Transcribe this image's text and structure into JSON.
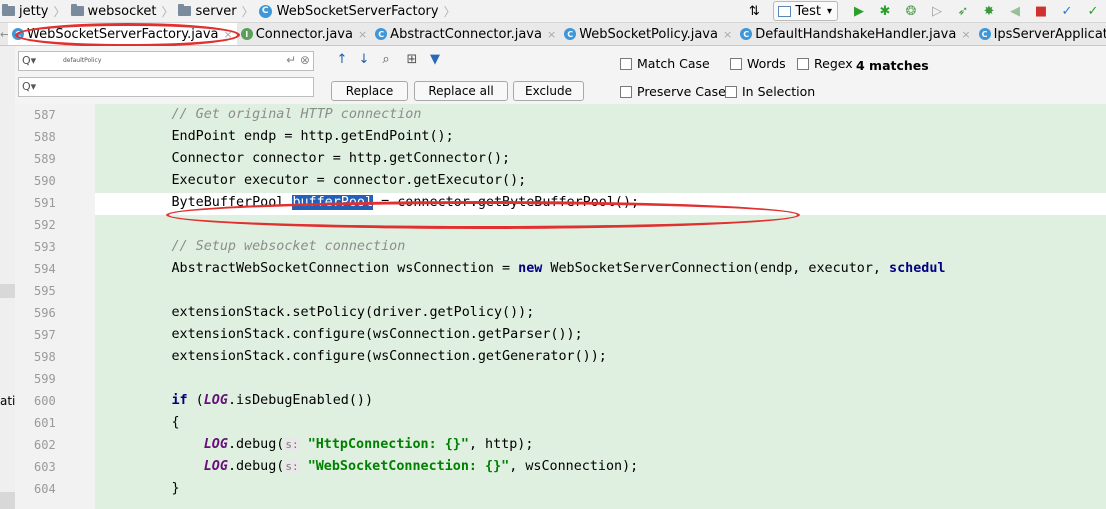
{
  "breadcrumb": [
    {
      "icon": "folder-icon",
      "label": "jetty"
    },
    {
      "icon": "folder-icon",
      "label": "websocket"
    },
    {
      "icon": "folder-icon",
      "label": "server"
    },
    {
      "icon": "class-icon",
      "label": "WebSocketServerFactory"
    }
  ],
  "toolbar": {
    "run_config": "Test",
    "tools": [
      "sort-icon",
      "run-icon",
      "debug-icon",
      "coverage-icon",
      "profile-icon",
      "build-icon",
      "attach-icon",
      "back-icon",
      "stop-icon",
      "vcs-update-icon",
      "vcs-commit-icon"
    ]
  },
  "tabs": [
    {
      "label": "WebSocketServerFactory.java",
      "icon_letter": "C",
      "icon_color": "#3d97d8",
      "active": true
    },
    {
      "label": "Connector.java",
      "icon_letter": "I",
      "icon_color": "#5aa05a",
      "active": false
    },
    {
      "label": "AbstractConnector.java",
      "icon_letter": "C",
      "icon_color": "#3d97d8",
      "active": false
    },
    {
      "label": "WebSocketPolicy.java",
      "icon_letter": "C",
      "icon_color": "#3d97d8",
      "active": false
    },
    {
      "label": "DefaultHandshakeHandler.java",
      "icon_letter": "C",
      "icon_color": "#3d97d8",
      "active": false
    },
    {
      "label": "IpsServerApplicati",
      "icon_letter": "C",
      "icon_color": "#3d97d8",
      "active": false
    }
  ],
  "find": {
    "search_value": "defaultPolicy",
    "replace_value": "",
    "replace_label": "Replace",
    "replace_all_label": "Replace all",
    "exclude_label": "Exclude",
    "match_case": "Match Case",
    "words": "Words",
    "regex": "Regex",
    "matches": "4 matches",
    "preserve_case": "Preserve Case",
    "in_selection": "In Selection"
  },
  "side_label": "ati",
  "code": {
    "highlight_color": "#e0f0e0",
    "selection_color": "#2260ba",
    "annotation_color": "#e03030",
    "top_partial_line": "586",
    "lines": [
      {
        "n": "587",
        "parts": [
          {
            "t": "        "
          },
          {
            "t": "// Get original HTTP connection",
            "c": "cm"
          }
        ]
      },
      {
        "n": "588",
        "parts": [
          {
            "t": "        EndPoint endp = http.getEndPoint();"
          }
        ]
      },
      {
        "n": "589",
        "parts": [
          {
            "t": "        Connector connector = http.getConnector();"
          }
        ]
      },
      {
        "n": "590",
        "parts": [
          {
            "t": "        Executor executor = connector.getExecutor();"
          }
        ]
      },
      {
        "n": "591",
        "current": true,
        "parts": [
          {
            "t": "        ByteBufferPool "
          },
          {
            "t": "bufferPool",
            "c": "sel"
          },
          {
            "t": " = connector.getByteBufferPool();"
          }
        ]
      },
      {
        "n": "592",
        "parts": [
          {
            "t": ""
          }
        ]
      },
      {
        "n": "593",
        "parts": [
          {
            "t": "        "
          },
          {
            "t": "// Setup websocket connection",
            "c": "cm"
          }
        ]
      },
      {
        "n": "594",
        "parts": [
          {
            "t": "        AbstractWebSocketConnection wsConnection = "
          },
          {
            "t": "new",
            "c": "kw"
          },
          {
            "t": " WebSocketServerConnection(endp, executor, "
          },
          {
            "t": "schedul",
            "c": "kw"
          }
        ]
      },
      {
        "n": "595",
        "parts": [
          {
            "t": ""
          }
        ]
      },
      {
        "n": "596",
        "parts": [
          {
            "t": "        extensionStack.setPolicy(driver.getPolicy());"
          }
        ]
      },
      {
        "n": "597",
        "parts": [
          {
            "t": "        extensionStack.configure(wsConnection.getParser());"
          }
        ]
      },
      {
        "n": "598",
        "parts": [
          {
            "t": "        extensionStack.configure(wsConnection.getGenerator());"
          }
        ]
      },
      {
        "n": "599",
        "parts": [
          {
            "t": ""
          }
        ]
      },
      {
        "n": "600",
        "parts": [
          {
            "t": "        "
          },
          {
            "t": "if",
            "c": "kw"
          },
          {
            "t": " ("
          },
          {
            "t": "LOG",
            "c": "sf"
          },
          {
            "t": ".isDebugEnabled())"
          }
        ]
      },
      {
        "n": "601",
        "parts": [
          {
            "t": "        {"
          }
        ]
      },
      {
        "n": "602",
        "parts": [
          {
            "t": "            "
          },
          {
            "t": "LOG",
            "c": "sf"
          },
          {
            "t": ".debug("
          },
          {
            "t": "s:",
            "c": "hint"
          },
          {
            "t": " "
          },
          {
            "t": "\"HttpConnection: {}\"",
            "c": "st"
          },
          {
            "t": ", http);"
          }
        ]
      },
      {
        "n": "603",
        "parts": [
          {
            "t": "            "
          },
          {
            "t": "LOG",
            "c": "sf"
          },
          {
            "t": ".debug("
          },
          {
            "t": "s:",
            "c": "hint"
          },
          {
            "t": " "
          },
          {
            "t": "\"WebSocketConnection: {}\"",
            "c": "st"
          },
          {
            "t": ", wsConnection);"
          }
        ]
      },
      {
        "n": "604",
        "parts": [
          {
            "t": "        }"
          }
        ]
      }
    ]
  }
}
